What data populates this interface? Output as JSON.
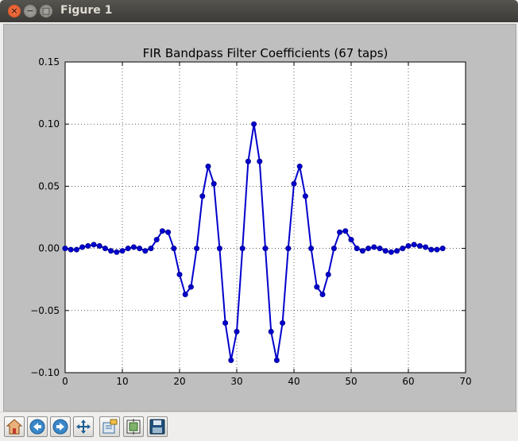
{
  "window": {
    "title": "Figure 1"
  },
  "toolbar": {
    "buttons": [
      {
        "name": "home-button",
        "icon": "home-icon"
      },
      {
        "name": "back-button",
        "icon": "arrow-left-icon"
      },
      {
        "name": "forward-button",
        "icon": "arrow-right-icon"
      },
      {
        "name": "pan-button",
        "icon": "move-icon"
      },
      {
        "name": "zoom-button",
        "icon": "zoom-rect-icon"
      },
      {
        "name": "subplots-button",
        "icon": "subplots-icon"
      },
      {
        "name": "save-button",
        "icon": "floppy-icon"
      }
    ]
  },
  "chart_data": {
    "type": "line",
    "title": "FIR Bandpass Filter Coefficients (67 taps)",
    "xlabel": "",
    "ylabel": "",
    "xlim": [
      0,
      70
    ],
    "ylim": [
      -0.1,
      0.15
    ],
    "xticks": [
      0,
      10,
      20,
      30,
      40,
      50,
      60,
      70
    ],
    "yticks": [
      -0.1,
      -0.05,
      0.0,
      0.05,
      0.1,
      0.15
    ],
    "xtick_labels": [
      "0",
      "10",
      "20",
      "30",
      "40",
      "50",
      "60",
      "70"
    ],
    "ytick_labels": [
      "−0.10",
      "−0.05",
      "0.00",
      "0.05",
      "0.10",
      "0.15"
    ],
    "grid": true,
    "series": [
      {
        "color": "#0000cc",
        "marker": "circle",
        "x": [
          0,
          1,
          2,
          3,
          4,
          5,
          6,
          7,
          8,
          9,
          10,
          11,
          12,
          13,
          14,
          15,
          16,
          17,
          18,
          19,
          20,
          21,
          22,
          23,
          24,
          25,
          26,
          27,
          28,
          29,
          30,
          31,
          32,
          33,
          34,
          35,
          36,
          37,
          38,
          39,
          40,
          41,
          42,
          43,
          44,
          45,
          46,
          47,
          48,
          49,
          50,
          51,
          52,
          53,
          54,
          55,
          56,
          57,
          58,
          59,
          60,
          61,
          62,
          63,
          64,
          65,
          66
        ],
        "y": [
          0.0,
          -0.001,
          -0.001,
          0.001,
          0.002,
          0.003,
          0.002,
          0.0,
          -0.002,
          -0.003,
          -0.002,
          0.0,
          0.001,
          0.0,
          -0.002,
          0.0,
          0.007,
          0.014,
          0.013,
          0.0,
          -0.021,
          -0.037,
          -0.031,
          0.0,
          0.042,
          0.066,
          0.052,
          0.0,
          -0.06,
          -0.09,
          -0.067,
          0.0,
          0.07,
          0.1,
          0.07,
          0.0,
          -0.067,
          -0.09,
          -0.06,
          0.0,
          0.052,
          0.066,
          0.042,
          0.0,
          -0.031,
          -0.037,
          -0.021,
          0.0,
          0.013,
          0.014,
          0.007,
          0.0,
          -0.002,
          0.0,
          0.001,
          0.0,
          -0.002,
          -0.003,
          -0.002,
          0.0,
          0.002,
          0.003,
          0.002,
          0.001,
          -0.001,
          -0.001,
          0.0
        ]
      }
    ]
  }
}
